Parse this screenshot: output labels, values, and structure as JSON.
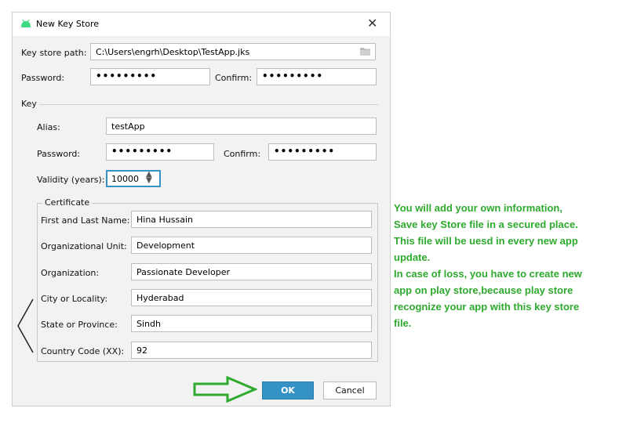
{
  "dialog": {
    "title": "New Key Store",
    "close_glyph": "✕",
    "keystore_path_label": "Key store path:",
    "keystore_path_value": "C:\\Users\\engrh\\Desktop\\TestApp.jks",
    "folder_icon": "folder-icon",
    "password_label": "Password:",
    "password_value": "•••••••••",
    "confirm_label": "Confirm:",
    "confirm_value": "•••••••••",
    "key_group_label": "Key",
    "alias_label": "Alias:",
    "alias_value": "testApp",
    "key_password_label": "Password:",
    "key_password_value": "•••••••••",
    "key_confirm_label": "Confirm:",
    "key_confirm_value": "•••••••••",
    "validity_label": "Validity (years):",
    "validity_value": "10000",
    "certificate_label": "Certificate",
    "cert_fields": [
      {
        "label": "First and Last Name:",
        "value": "Hina Hussain"
      },
      {
        "label": "Organizational Unit:",
        "value": "Development"
      },
      {
        "label": "Organization:",
        "value": "Passionate Developer"
      },
      {
        "label": "City or Locality:",
        "value": "Hyderabad"
      },
      {
        "label": "State or Province:",
        "value": "Sindh"
      },
      {
        "label": "Country Code (XX):",
        "value": "92"
      }
    ],
    "ok_label": "OK",
    "cancel_label": "Cancel"
  },
  "annotation": {
    "color": "#2eaa2e",
    "lines": [
      "You will add your own information,",
      "Save key Store file in a secured place.",
      "This file will be uesd in every  new app",
      "update.",
      "In case of loss, you have to create new",
      "app on play store,because play store",
      "recognize your app with this key store",
      "file."
    ]
  },
  "colors": {
    "accent": "#3592c4",
    "annotation_arrow": "#2eaa2e"
  }
}
